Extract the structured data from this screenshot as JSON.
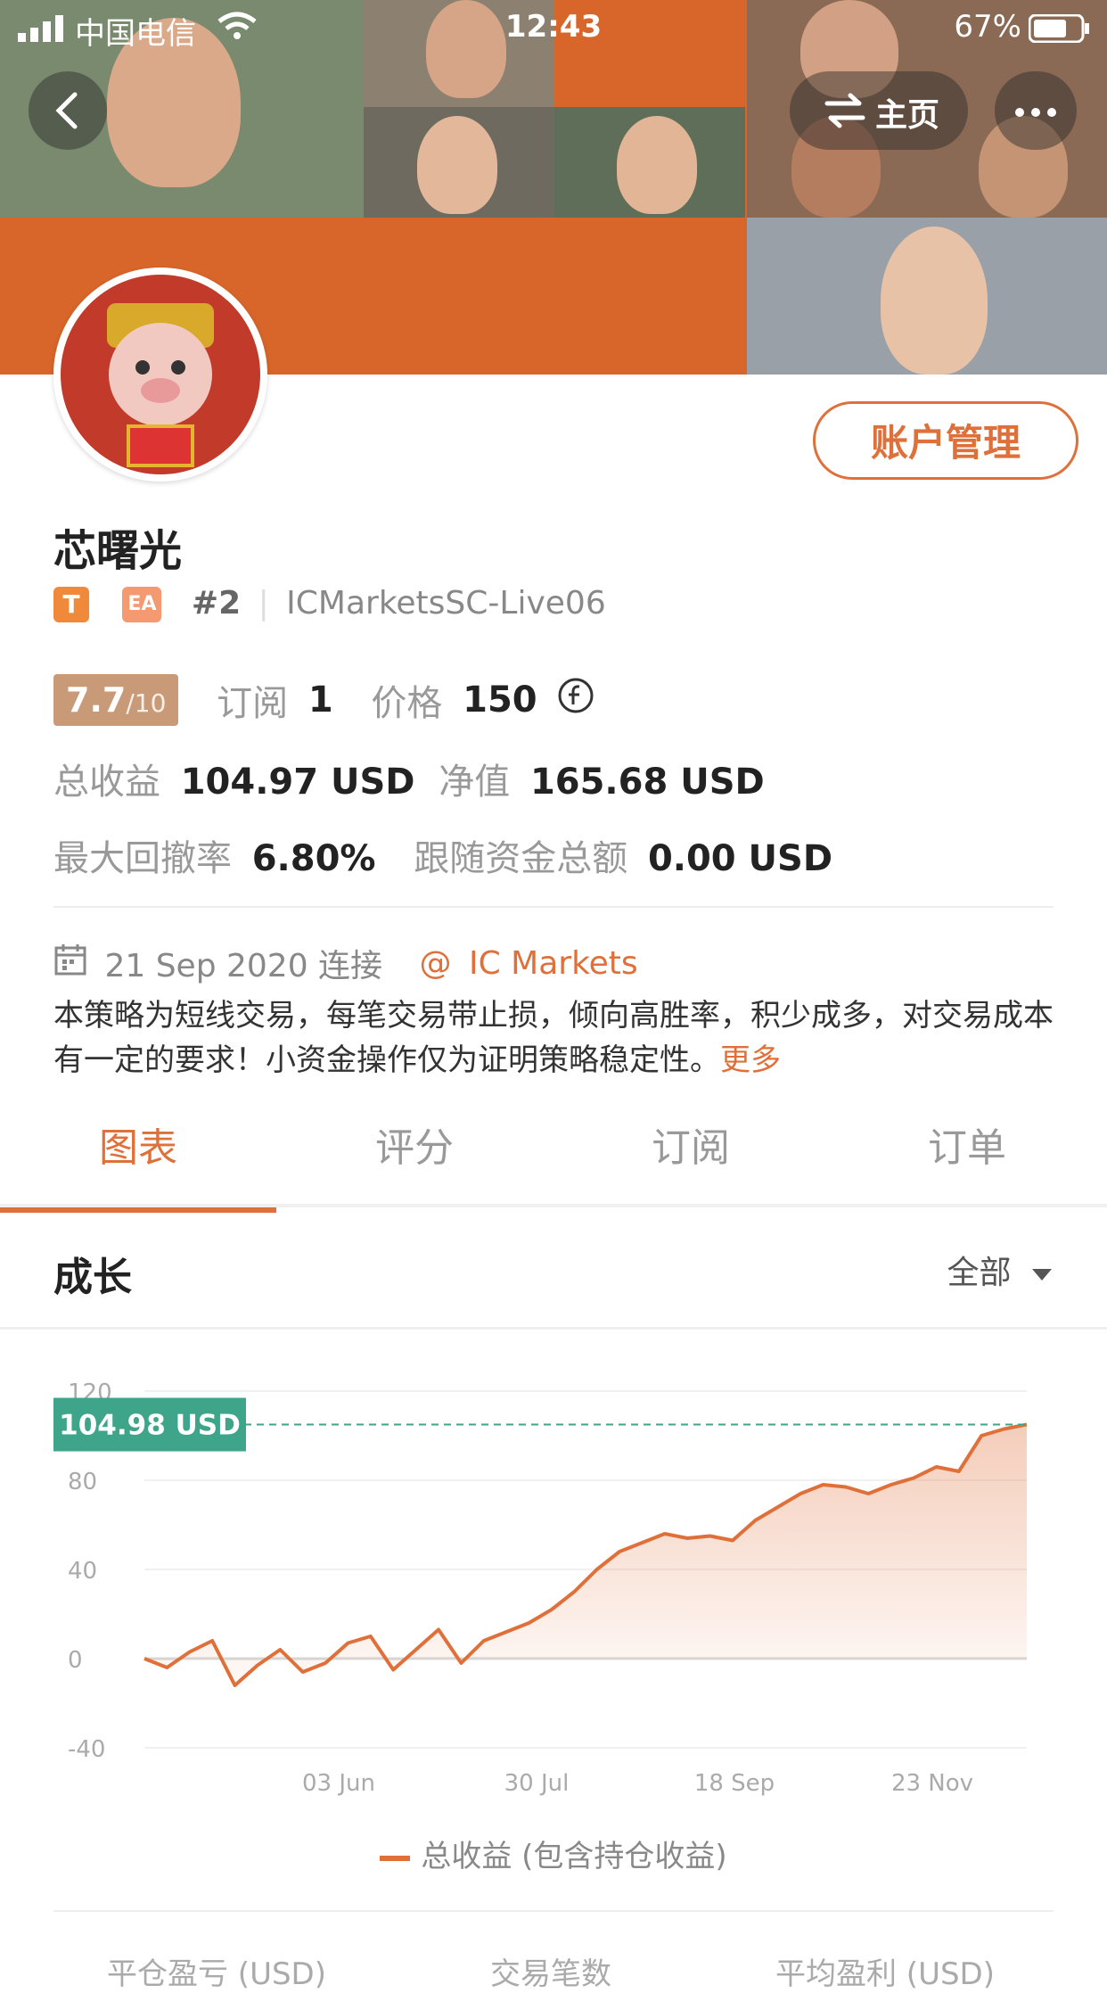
{
  "status_bar": {
    "carrier": "中国电信",
    "time": "12:43",
    "battery": "67%"
  },
  "header": {
    "home_label": "主页"
  },
  "profile": {
    "manage_button": "账户管理",
    "name": "芯曙光",
    "badge_t": "T",
    "badge_ea": "EA",
    "rank": "#2",
    "server": "ICMarketsSC-Live06",
    "score": "7.7",
    "score_max": "/10",
    "subscribe_label": "订阅",
    "subscribe_count": "1",
    "price_label": "价格",
    "price_value": "150",
    "total_profit_label": "总收益",
    "total_profit_value": "104.97 USD",
    "equity_label": "净值",
    "equity_value": "165.68 USD",
    "max_drawdown_label": "最大回撤率",
    "max_drawdown_value": "6.80%",
    "follow_funds_label": "跟随资金总额",
    "follow_funds_value": "0.00 USD",
    "connected_date": "21 Sep 2020 连接",
    "broker": "IC Markets",
    "description": "本策略为短线交易，每笔交易带止损，倾向高胜率，积少成多，对交易成本有一定的要求！小资金操作仅为证明策略稳定性。",
    "more_link": "更多"
  },
  "tabs": [
    {
      "label": "图表"
    },
    {
      "label": "评分"
    },
    {
      "label": "订阅"
    },
    {
      "label": "订单"
    }
  ],
  "chart_section": {
    "title": "成长",
    "filter": "全部"
  },
  "chart_data": {
    "type": "area",
    "yticks": [
      "120",
      "80",
      "40",
      "0",
      "-40"
    ],
    "ylim": [
      -40,
      120
    ],
    "xticks": [
      "03 Jun",
      "30 Jul",
      "18 Sep",
      "23 Nov"
    ],
    "current_label": "104.98 USD",
    "current_value": 104.98,
    "series": [
      {
        "name": "总收益 (包含持仓收益)",
        "values": [
          0,
          -4,
          3,
          8,
          -12,
          -3,
          4,
          -6,
          -2,
          7,
          10,
          -5,
          4,
          13,
          -2,
          8,
          12,
          16,
          22,
          30,
          40,
          48,
          52,
          56,
          54,
          55,
          53,
          62,
          68,
          74,
          78,
          77,
          74,
          78,
          81,
          86,
          84,
          100,
          103,
          105
        ]
      }
    ]
  },
  "bottom_stats": {
    "left": "平仓盈亏 (USD)",
    "middle": "交易笔数",
    "right": "平均盈利 (USD)"
  },
  "colors": {
    "accent": "#e0703a",
    "score_bg": "#c99a78",
    "current_tag": "#3fa58a"
  }
}
